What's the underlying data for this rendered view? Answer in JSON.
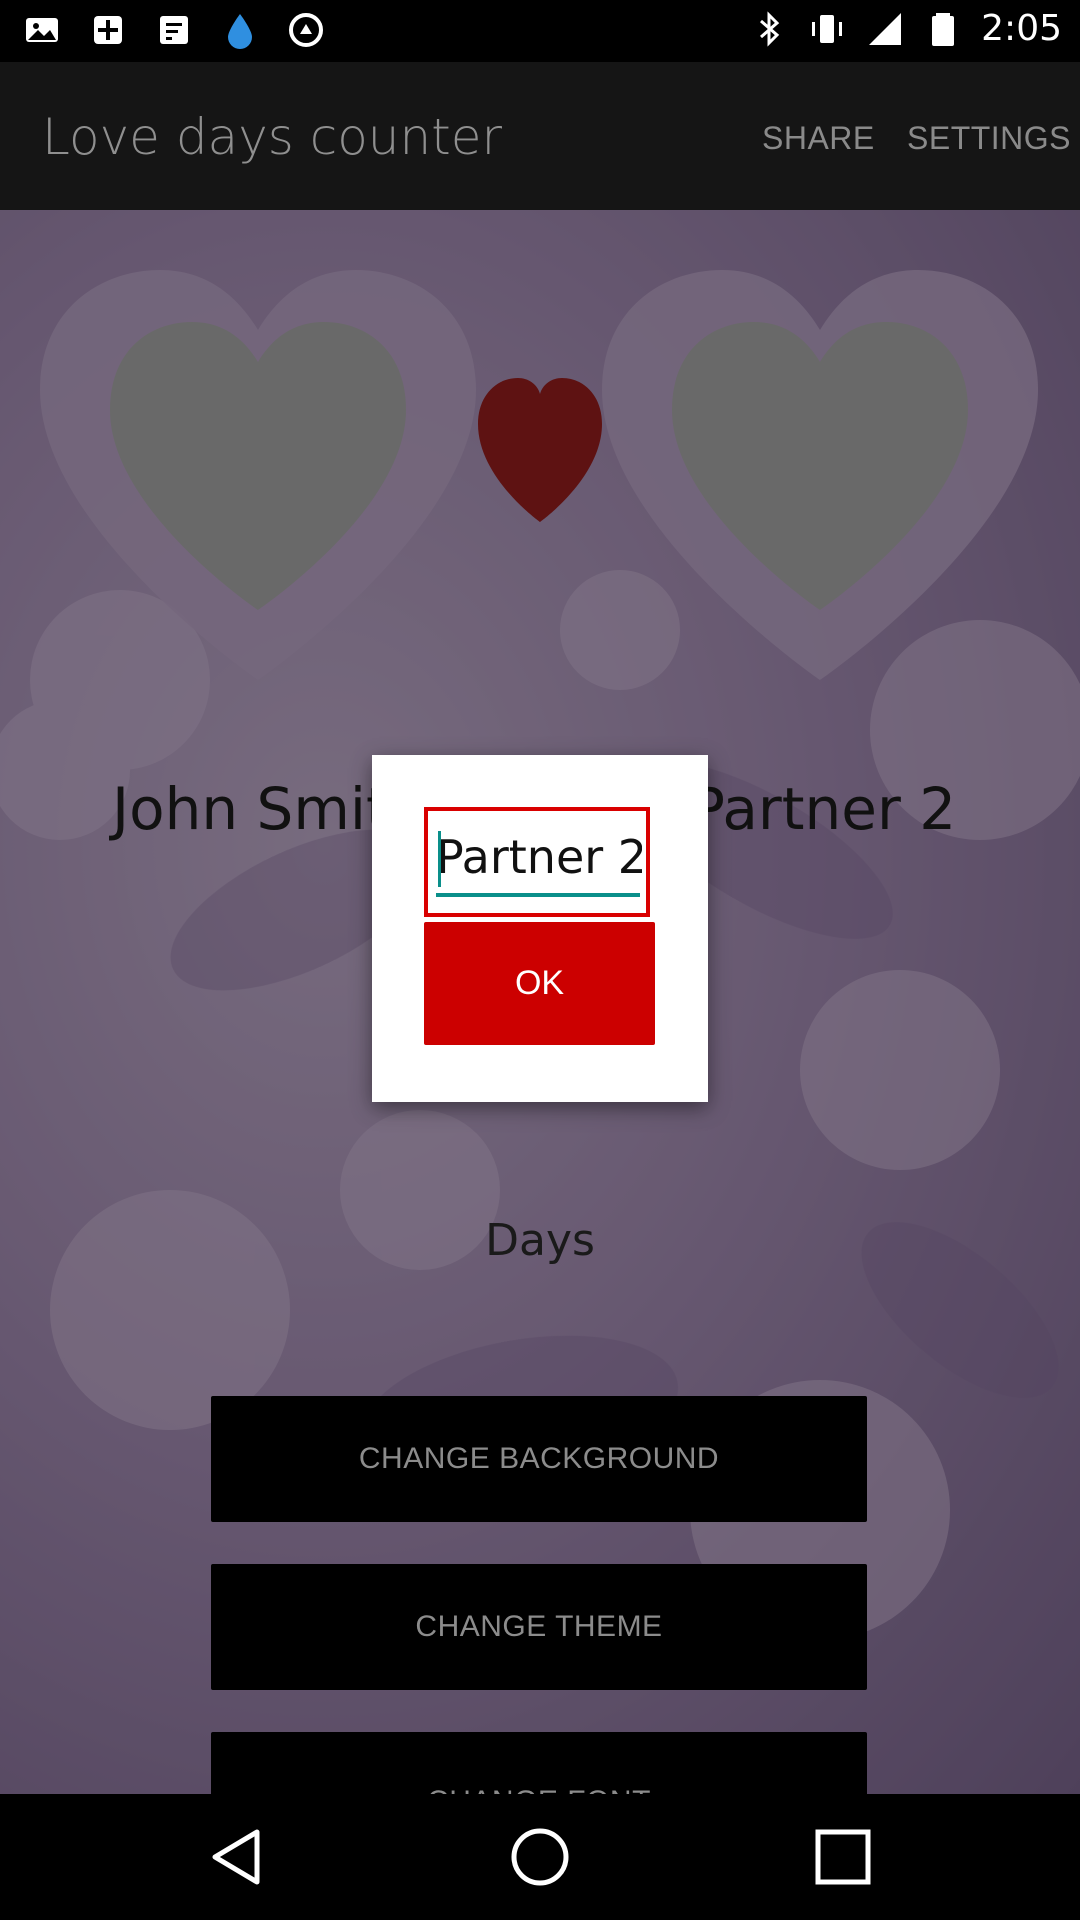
{
  "status_bar": {
    "time": "2:05",
    "left_icons": [
      "gallery-icon",
      "dnd-icon",
      "message-icon",
      "drop-icon",
      "data-icon"
    ],
    "right_icons": [
      "bluetooth-icon",
      "vibrate-icon",
      "signal-icon",
      "battery-icon"
    ]
  },
  "app_bar": {
    "title": "Love days counter",
    "share_label": "SHARE",
    "settings_label": "SETTINGS"
  },
  "main": {
    "partner1_name": "John Smit",
    "partner2_name": "Partner 2",
    "days_label": "Days",
    "buttons": {
      "change_background": "CHANGE BACKGROUND",
      "change_theme": "CHANGE THEME",
      "change_font": "CHANGE FONT"
    }
  },
  "dialog": {
    "input_value": "Partner 2",
    "ok_label": "OK"
  },
  "nav_bar": {
    "icons": [
      "back-icon",
      "home-icon",
      "recents-icon"
    ]
  },
  "colors": {
    "accent_red": "#cc0000",
    "input_accent": "#0a8f8a",
    "heart_red": "#8b0000"
  }
}
